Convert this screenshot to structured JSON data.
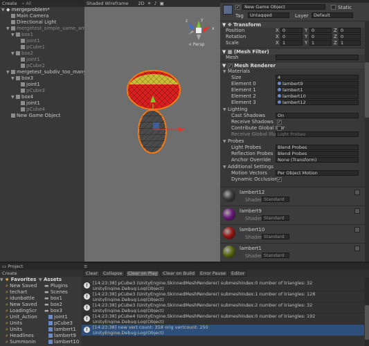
{
  "hierarchy": {
    "create_label": "Create",
    "search_label": "All",
    "scene_name": "mergeproblem*",
    "items": [
      {
        "label": "Main Camera",
        "depth": 1,
        "arrow": "",
        "dim": false
      },
      {
        "label": "Directional Light",
        "depth": 1,
        "arrow": "",
        "dim": false
      },
      {
        "label": "mergetest_simple_same_amou",
        "depth": 1,
        "arrow": "▼",
        "dim": true
      },
      {
        "label": "box1",
        "depth": 2,
        "arrow": "▼",
        "dim": true
      },
      {
        "label": "joint1",
        "depth": 3,
        "arrow": "",
        "dim": true
      },
      {
        "label": "pCube1",
        "depth": 3,
        "arrow": "",
        "dim": true
      },
      {
        "label": "box2",
        "depth": 2,
        "arrow": "▼",
        "dim": true
      },
      {
        "label": "joint1",
        "depth": 3,
        "arrow": "",
        "dim": true
      },
      {
        "label": "pCube2",
        "depth": 3,
        "arrow": "",
        "dim": true
      },
      {
        "label": "mergetest_subdiv_too_many_t",
        "depth": 1,
        "arrow": "▼",
        "dim": false
      },
      {
        "label": "box3",
        "depth": 2,
        "arrow": "▼",
        "dim": false
      },
      {
        "label": "joint1",
        "depth": 3,
        "arrow": "",
        "dim": false
      },
      {
        "label": "pCube3",
        "depth": 3,
        "arrow": "",
        "dim": true
      },
      {
        "label": "box4",
        "depth": 2,
        "arrow": "▼",
        "dim": false
      },
      {
        "label": "joint1",
        "depth": 3,
        "arrow": "",
        "dim": false
      },
      {
        "label": "pCube4",
        "depth": 3,
        "arrow": "",
        "dim": true
      },
      {
        "label": "New Game Object",
        "depth": 1,
        "arrow": "",
        "dim": false
      }
    ]
  },
  "scene": {
    "shading_mode": "Shaded Wireframe",
    "mode_2d": "2D",
    "persp_label": "< Persp",
    "gizmo_y": "y",
    "gizmo_x": "x",
    "gizmo_z": "z"
  },
  "inspector": {
    "object_name": "New Game Object",
    "static_label": "Static",
    "tag_label": "Tag",
    "tag_value": "Untagged",
    "layer_label": "Layer",
    "layer_value": "Default",
    "transform": {
      "title": "Transform",
      "position_label": "Position",
      "rotation_label": "Rotation",
      "scale_label": "Scale",
      "position": {
        "x": "0",
        "y": "0",
        "z": "0"
      },
      "rotation": {
        "x": "0",
        "y": "0",
        "z": "0"
      },
      "scale": {
        "x": "1",
        "y": "1",
        "z": "1"
      },
      "x": "X",
      "y": "Y",
      "z": "Z"
    },
    "mesh_filter": {
      "title": "(Mesh Filter)",
      "mesh_label": "Mesh",
      "mesh_value": ""
    },
    "mesh_renderer": {
      "title": "Mesh Renderer",
      "materials_label": "Materials",
      "size_label": "Size",
      "size_value": "4",
      "elements": [
        {
          "label": "Element 0",
          "value": "lambert9"
        },
        {
          "label": "Element 1",
          "value": "lambert1"
        },
        {
          "label": "Element 2",
          "value": "lambert10"
        },
        {
          "label": "Element 3",
          "value": "lambert12"
        }
      ],
      "lighting_label": "Lighting",
      "cast_shadows_label": "Cast Shadows",
      "cast_shadows_value": "On",
      "receive_shadows_label": "Receive Shadows",
      "contribute_gi_label": "Contribute Global Illur",
      "receive_gi_label": "Receive Global Illumir",
      "receive_gi_value": "Light Probes",
      "probes_label": "Probes",
      "light_probes_label": "Light Probes",
      "light_probes_value": "Blend Probes",
      "reflection_probes_label": "Reflection Probes",
      "reflection_probes_value": "Blend Probes",
      "anchor_override_label": "Anchor Override",
      "anchor_override_value": "None (Transform)",
      "additional_label": "Additional Settings",
      "motion_vectors_label": "Motion Vectors",
      "motion_vectors_value": "Per Object Motion",
      "dynamic_occlusion_label": "Dynamic Occlusion"
    },
    "materials": [
      {
        "name": "lambert12",
        "shader_label": "Shader",
        "shader_value": "Standard",
        "color": "#3a3a3a"
      },
      {
        "name": "lambert9",
        "shader_label": "Shader",
        "shader_value": "Standard",
        "color": "#6a1a7a"
      },
      {
        "name": "lambert10",
        "shader_label": "Shader",
        "shader_value": "Standard",
        "color": "#9a1414"
      },
      {
        "name": "lambert1",
        "shader_label": "Shader",
        "shader_value": "Standard",
        "color": "#5a6a10"
      }
    ]
  },
  "project": {
    "project_tab": "Project",
    "console_tab": "Console",
    "create_label": "Create",
    "favorites_label": "Favorites",
    "favorites": [
      "New Saved",
      "techart",
      "idunbattle",
      "New Saved",
      "LoadingScr",
      "Unit_Action",
      "Units",
      "Units",
      "Headlines",
      "Summonin",
      "FX"
    ],
    "assets_label": "Assets",
    "assets_tree": [
      "Plugins",
      "Scenes",
      "box1",
      "box2",
      "box3"
    ],
    "assets_files": [
      "joint1",
      "pCube3",
      "lambert1",
      "lambert9",
      "lambert10",
      "pCube1"
    ]
  },
  "console": {
    "buttons": [
      "Clear",
      "Collapse",
      "Clear on Play",
      "Clear on Build",
      "Error Pause",
      "Editor"
    ],
    "logs": [
      {
        "line1": "[14:23:38] pCube3 (UnityEngine.SkinnedMeshRenderer) submeshindex:0 number of triangles: 32",
        "line2": "UnityEngine.Debug:Log(Object)",
        "selected": false
      },
      {
        "line1": "[14:23:38] pCube3 (UnityEngine.SkinnedMeshRenderer) submeshindex:1 number of triangles: 128",
        "line2": "UnityEngine.Debug:Log(Object)",
        "selected": false
      },
      {
        "line1": "[14:23:38] pCube3 (UnityEngine.SkinnedMeshRenderer) submeshindex:2 number of triangles: 32",
        "line2": "UnityEngine.Debug:Log(Object)",
        "selected": false
      },
      {
        "line1": "[14:23:38] pCube4 (UnityEngine.SkinnedMeshRenderer) submeshindex:0 number of triangles: 192",
        "line2": "UnityEngine.Debug:Log(Object)",
        "selected": false
      },
      {
        "line1": "[14:23:38] new vert count: 358 orig vertcount: 250",
        "line2": "UnityEngine.Debug:Log(Object)",
        "selected": true
      }
    ]
  },
  "colors": {
    "accent": "#2d4f7a",
    "selection_outline": "#ff7a10",
    "gizmo_y": "#7ec828",
    "gizmo_x": "#e0352a",
    "gizmo_z": "#3a6ed8"
  }
}
